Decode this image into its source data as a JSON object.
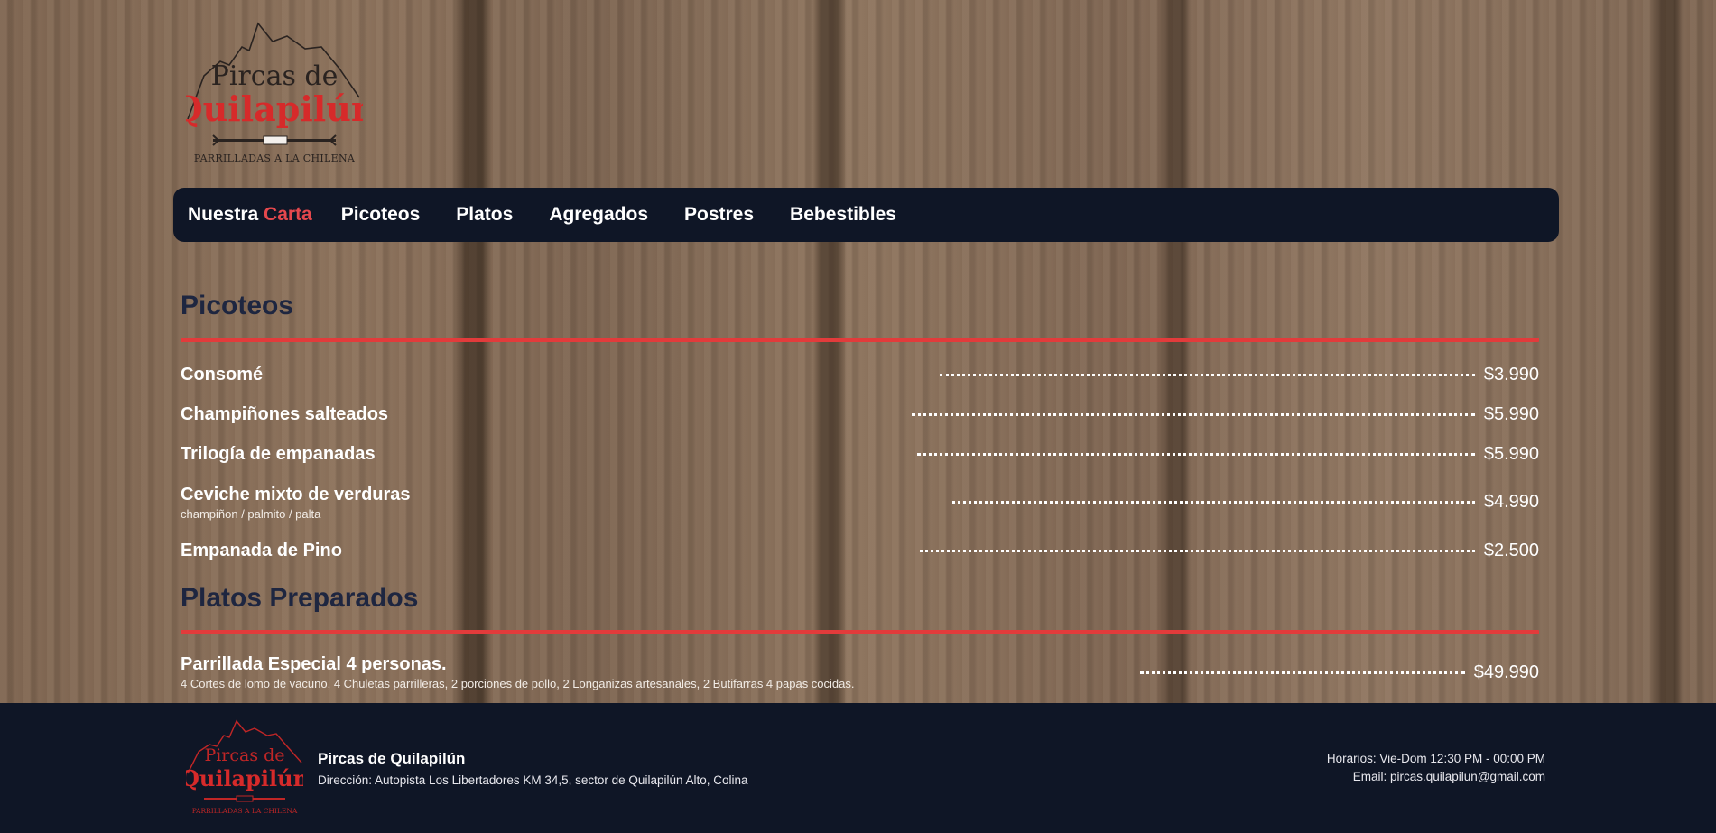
{
  "logo": {
    "line1": "Pircas de",
    "line2": "Quilapilún",
    "tagline": "Parrilladas a la chilena"
  },
  "nav": {
    "brand_prefix": "Nuestra",
    "brand_accent": "Carta",
    "links": [
      "Picoteos",
      "Platos",
      "Agregados",
      "Postres",
      "Bebestibles"
    ]
  },
  "sections": [
    {
      "title": "Picoteos",
      "items": [
        {
          "name": "Consomé",
          "desc": "",
          "price": "$3.990"
        },
        {
          "name": "Champiñones salteados",
          "desc": "",
          "price": "$5.990"
        },
        {
          "name": "Trilogía de empanadas",
          "desc": "",
          "price": "$5.990"
        },
        {
          "name": "Ceviche mixto de verduras",
          "desc": "champiñon / palmito / palta",
          "price": "$4.990"
        },
        {
          "name": "Empanada de Pino",
          "desc": "",
          "price": "$2.500"
        }
      ]
    },
    {
      "title": "Platos Preparados",
      "items": [
        {
          "name": "Parrillada Especial 4 personas.",
          "desc": "4 Cortes de lomo de vacuno, 4 Chuletas parrilleras, 2 porciones de pollo, 2 Longanizas artesanales, 2 Butifarras 4 papas cocidas.",
          "price": "$49.990"
        }
      ]
    }
  ],
  "footer": {
    "name": "Pircas de Quilapilún",
    "address": "Dirección: Autopista Los Libertadores KM 34,5, sector de Quilapilún Alto, Colina",
    "hours": "Horarios: Vie-Dom 12:30 PM - 00:00 PM",
    "email": "Email: pircas.quilapilun@gmail.com"
  },
  "colors": {
    "navbar": "#0f1626",
    "accent": "#e5484d",
    "rule": "#e23b3b",
    "section_title": "#1e2640"
  },
  "icons": [
    "mountain-logo-icon",
    "fork-knife-icon"
  ]
}
